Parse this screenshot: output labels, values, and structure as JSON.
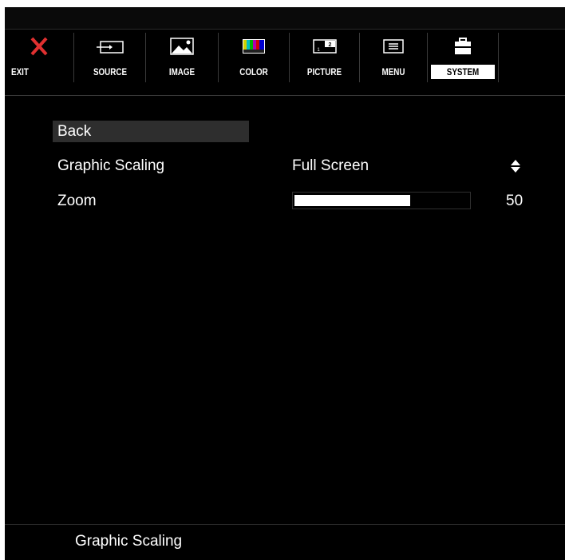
{
  "toolbar": {
    "tabs": [
      {
        "label": "EXIT",
        "icon": "close-icon"
      },
      {
        "label": "SOURCE",
        "icon": "input-source-icon"
      },
      {
        "label": "IMAGE",
        "icon": "image-icon"
      },
      {
        "label": "COLOR",
        "icon": "color-bars-icon"
      },
      {
        "label": "PICTURE",
        "icon": "picture-in-picture-icon"
      },
      {
        "label": "MENU",
        "icon": "menu-icon"
      },
      {
        "label": "SYSTEM",
        "icon": "toolbox-icon"
      }
    ],
    "active_tab": "SYSTEM"
  },
  "menu": {
    "back_label": "Back",
    "graphic_scaling": {
      "label": "Graphic Scaling",
      "value": "Full Screen"
    },
    "zoom": {
      "label": "Zoom",
      "value": "50",
      "fraction": 0.66
    }
  },
  "status_bar": {
    "text": "Graphic Scaling"
  },
  "colors": {
    "background": "#000000",
    "text": "#ffffff",
    "exit_x": "#e03030",
    "highlight": "#2e2e2e"
  }
}
